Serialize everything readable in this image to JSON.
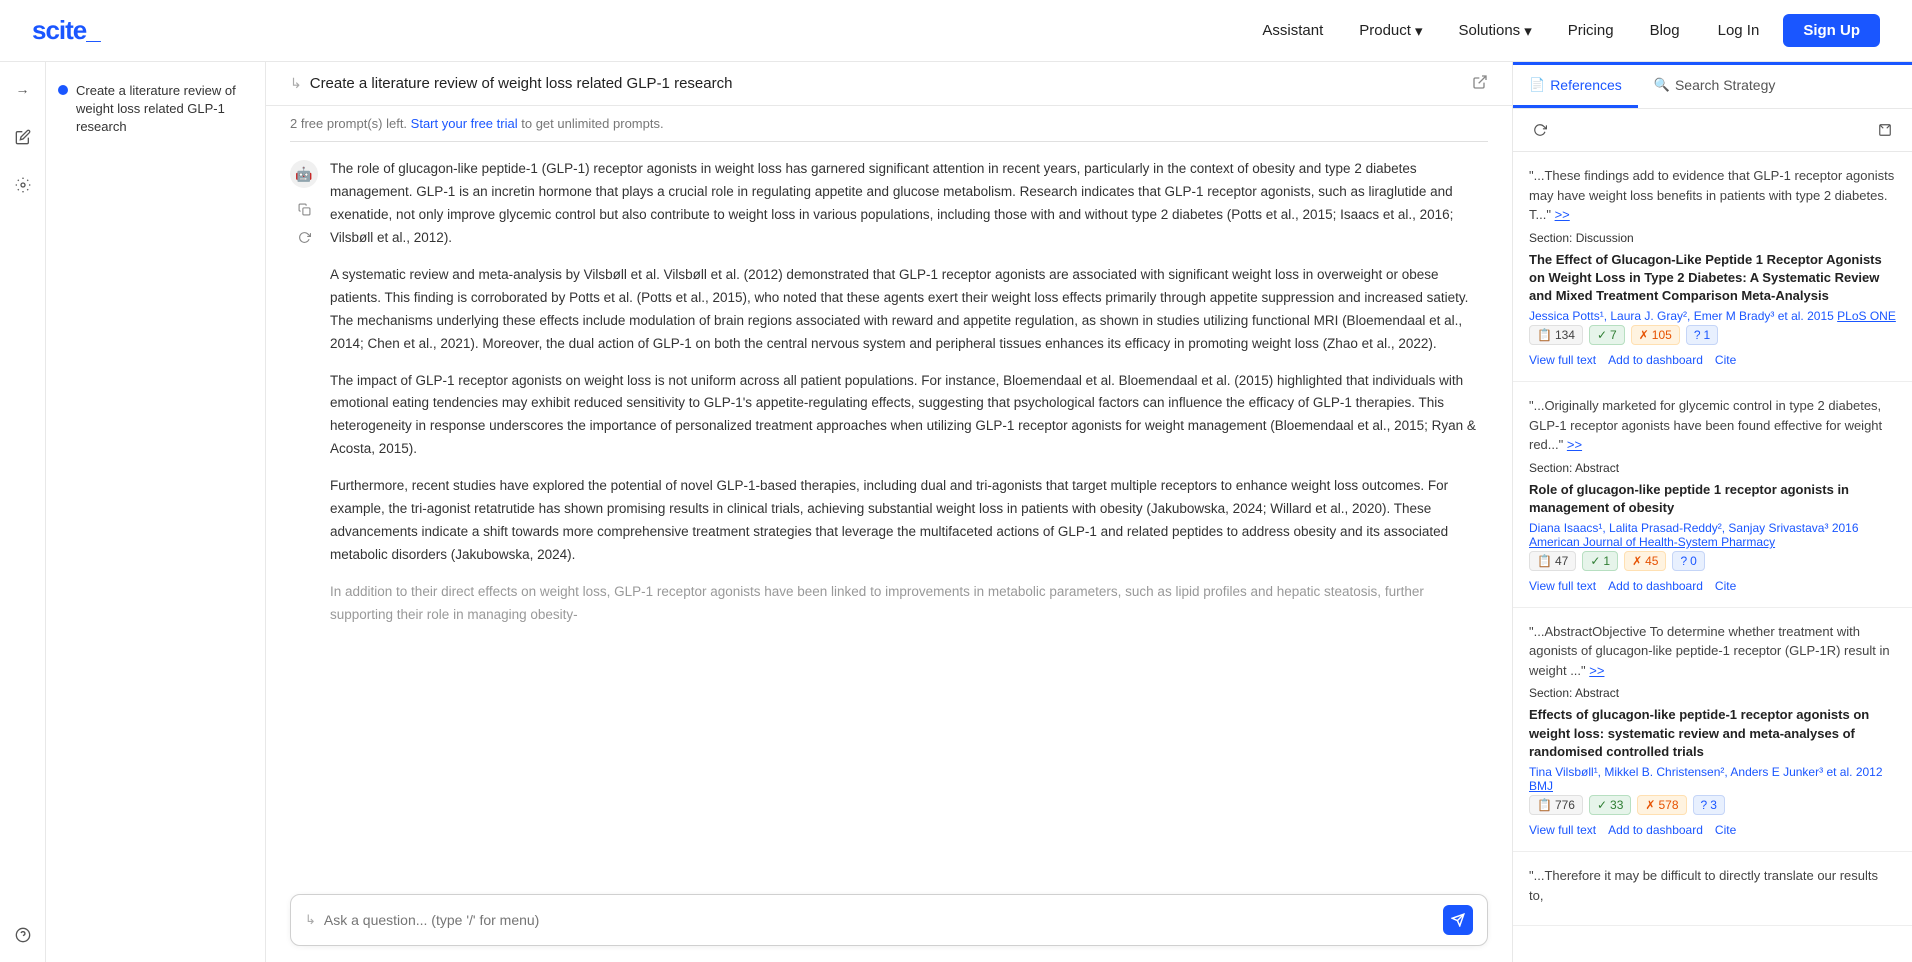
{
  "nav": {
    "logo": "scite_",
    "items": [
      {
        "label": "Assistant",
        "has_dropdown": false
      },
      {
        "label": "Product",
        "has_dropdown": true
      },
      {
        "label": "Solutions",
        "has_dropdown": true
      },
      {
        "label": "Pricing",
        "has_dropdown": false
      },
      {
        "label": "Blog",
        "has_dropdown": false
      }
    ],
    "login_label": "Log In",
    "signup_label": "Sign Up"
  },
  "sidebar": {
    "icons": [
      {
        "name": "arrow-right-icon",
        "symbol": "→"
      },
      {
        "name": "edit-icon",
        "symbol": "✏"
      },
      {
        "name": "settings-icon",
        "symbol": "⚙"
      },
      {
        "name": "help-icon",
        "symbol": "?"
      }
    ]
  },
  "history": {
    "items": [
      {
        "text": "Create a literature review of weight loss related GLP-1 research"
      }
    ]
  },
  "chat": {
    "header_arrow": "↳",
    "title": "Create a literature review of weight loss related GLP-1 research",
    "free_prompts": "2 free prompt(s) left.",
    "free_prompts_link": "Start your free trial",
    "free_prompts_suffix": " to get unlimited prompts.",
    "message_icon": "🤖",
    "paragraphs": [
      "The role of glucagon-like peptide-1 (GLP-1) receptor agonists in weight loss has garnered significant attention in recent years, particularly in the context of obesity and type 2 diabetes management. GLP-1 is an incretin hormone that plays a crucial role in regulating appetite and glucose metabolism. Research indicates that GLP-1 receptor agonists, such as liraglutide and exenatide, not only improve glycemic control but also contribute to weight loss in various populations, including those with and without type 2 diabetes (Potts et al., 2015; Isaacs et al., 2016; Vilsbøll et al., 2012).",
      "A systematic review and meta-analysis by Vilsbøll et al. Vilsbøll et al. (2012) demonstrated that GLP-1 receptor agonists are associated with significant weight loss in overweight or obese patients. This finding is corroborated by Potts et al. (Potts et al., 2015), who noted that these agents exert their weight loss effects primarily through appetite suppression and increased satiety. The mechanisms underlying these effects include modulation of brain regions associated with reward and appetite regulation, as shown in studies utilizing functional MRI (Bloemendaal et al., 2014; Chen et al., 2021). Moreover, the dual action of GLP-1 on both the central nervous system and peripheral tissues enhances its efficacy in promoting weight loss (Zhao et al., 2022).",
      "The impact of GLP-1 receptor agonists on weight loss is not uniform across all patient populations. For instance, Bloemendaal et al. Bloemendaal et al. (2015) highlighted that individuals with emotional eating tendencies may exhibit reduced sensitivity to GLP-1's appetite-regulating effects, suggesting that psychological factors can influence the efficacy of GLP-1 therapies. This heterogeneity in response underscores the importance of personalized treatment approaches when utilizing GLP-1 receptor agonists for weight management (Bloemendaal et al., 2015; Ryan & Acosta, 2015).",
      "Furthermore, recent studies have explored the potential of novel GLP-1-based therapies, including dual and tri-agonists that target multiple receptors to enhance weight loss outcomes. For example, the tri-agonist retatrutide has shown promising results in clinical trials, achieving substantial weight loss in patients with obesity (Jakubowska, 2024; Willard et al., 2020). These advancements indicate a shift towards more comprehensive treatment strategies that leverage the multifaceted actions of GLP-1 and related peptides to address obesity and its associated metabolic disorders (Jakubowska, 2024).",
      "In addition to their direct effects on weight loss, GLP-1 receptor agonists have been linked to improvements in metabolic parameters, such as lipid profiles and hepatic steatosis, further supporting their role in managing obesity-"
    ],
    "input_placeholder": "Ask a question... (type '/' for menu)",
    "input_arrow": "↳"
  },
  "references": {
    "tabs": [
      {
        "label": "References",
        "icon": "📄",
        "active": true
      },
      {
        "label": "Search Strategy",
        "icon": "🔍",
        "active": false
      }
    ],
    "cards": [
      {
        "quote": "\"...These findings add to evidence that GLP-1 receptor agonists may have weight loss benefits in patients with type 2 diabetes. T...\"",
        "quote_link": ">>",
        "section_label": "Section:",
        "section": "Discussion",
        "title": "The Effect of Glucagon-Like Peptide 1 Receptor Agonists on Weight Loss in Type 2 Diabetes: A Systematic Review and Mixed Treatment Comparison Meta-Analysis",
        "authors": "Jessica Potts¹, Laura J. Gray², Emer M Brady³",
        "authors_extra": "et al.",
        "year": "2015",
        "journal": "PLoS ONE",
        "stats": [
          {
            "icon": "📋",
            "value": "134",
            "type": "default"
          },
          {
            "icon": "✓",
            "value": "7",
            "type": "green"
          },
          {
            "icon": "✗",
            "value": "105",
            "type": "orange"
          },
          {
            "icon": "?",
            "value": "1",
            "type": "blue"
          }
        ],
        "actions": [
          "View full text",
          "Add to dashboard",
          "Cite"
        ]
      },
      {
        "quote": "\"...Originally marketed for glycemic control in type 2 diabetes, GLP-1 receptor agonists have been found effective for weight red...\"",
        "quote_link": ">>",
        "section_label": "Section:",
        "section": "Abstract",
        "title": "Role of glucagon-like peptide 1 receptor agonists in management of obesity",
        "authors": "Diana Isaacs¹, Lalita Prasad-Reddy², Sanjay Srivastava³",
        "authors_extra": "",
        "year": "2016",
        "journal": "American Journal of Health-System Pharmacy",
        "stats": [
          {
            "icon": "📋",
            "value": "47",
            "type": "default"
          },
          {
            "icon": "✓",
            "value": "1",
            "type": "green"
          },
          {
            "icon": "✗",
            "value": "45",
            "type": "orange"
          },
          {
            "icon": "?",
            "value": "0",
            "type": "blue"
          }
        ],
        "actions": [
          "View full text",
          "Add to dashboard",
          "Cite"
        ]
      },
      {
        "quote": "\"...AbstractObjective To determine whether treatment with agonists of glucagon-like peptide-1 receptor (GLP-1R) result in weight ...\"",
        "quote_link": ">>",
        "section_label": "Section:",
        "section": "Abstract",
        "title": "Effects of glucagon-like peptide-1 receptor agonists on weight loss: systematic review and meta-analyses of randomised controlled trials",
        "authors": "Tina Vilsbøll¹, Mikkel B. Christensen², Anders E Junker³",
        "authors_extra": "et al.",
        "year": "2012",
        "journal": "BMJ",
        "stats": [
          {
            "icon": "📋",
            "value": "776",
            "type": "default"
          },
          {
            "icon": "✓",
            "value": "33",
            "type": "green"
          },
          {
            "icon": "✗",
            "value": "578",
            "type": "orange"
          },
          {
            "icon": "?",
            "value": "3",
            "type": "blue"
          }
        ],
        "actions": [
          "View full text",
          "Add to dashboard",
          "Cite"
        ]
      },
      {
        "quote": "\"...Therefore it may be difficult to directly translate our results to,",
        "quote_link": "",
        "section_label": "",
        "section": "",
        "title": "",
        "authors": "",
        "authors_extra": "",
        "year": "",
        "journal": "",
        "stats": [],
        "actions": []
      }
    ]
  }
}
